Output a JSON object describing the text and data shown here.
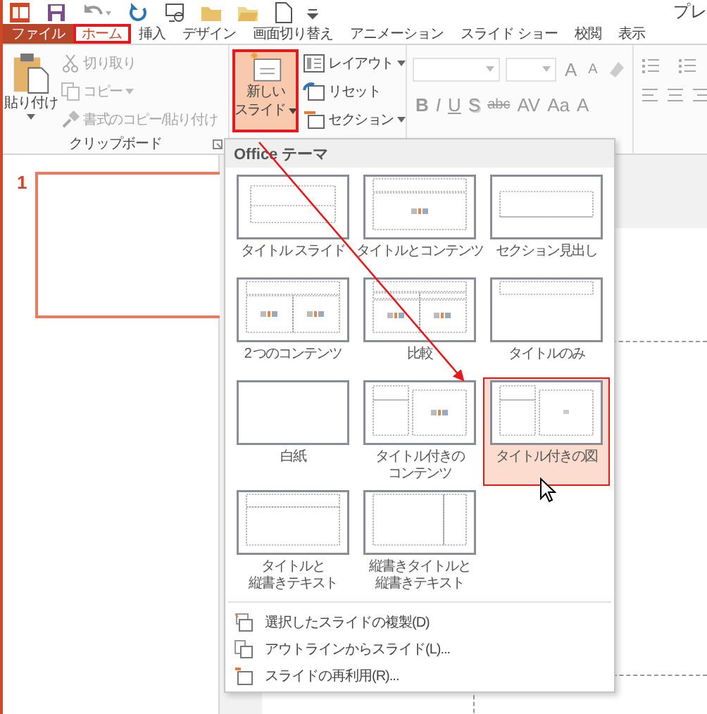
{
  "title_bar": {
    "title": "プレ"
  },
  "tabs": [
    {
      "label": "ファイル",
      "kind": "file",
      "selected": false,
      "highlighted": false
    },
    {
      "label": "ホーム",
      "kind": "tab",
      "selected": true,
      "highlighted": true
    },
    {
      "label": "挿入",
      "kind": "tab",
      "selected": false,
      "highlighted": false
    },
    {
      "label": "デザイン",
      "kind": "tab",
      "selected": false,
      "highlighted": false
    },
    {
      "label": "画面切り替え",
      "kind": "tab",
      "selected": false,
      "highlighted": false
    },
    {
      "label": "アニメーション",
      "kind": "tab",
      "selected": false,
      "highlighted": false
    },
    {
      "label": "スライド ショー",
      "kind": "tab",
      "selected": false,
      "highlighted": false
    },
    {
      "label": "校閲",
      "kind": "tab",
      "selected": false,
      "highlighted": false
    },
    {
      "label": "表示",
      "kind": "tab",
      "selected": false,
      "highlighted": false
    }
  ],
  "clipboard_group": {
    "title": "クリップボード",
    "paste": {
      "label": "貼り付け"
    },
    "commands": [
      {
        "label": "切り取り",
        "disabled": true,
        "dropdown": false
      },
      {
        "label": "コピー",
        "disabled": true,
        "dropdown": true
      },
      {
        "label": "書式のコピー/貼り付け",
        "disabled": true,
        "dropdown": false
      }
    ]
  },
  "slides_group": {
    "new_slide": {
      "lines": [
        "新しい",
        "スライド"
      ],
      "pressed": true,
      "highlighted": true
    },
    "commands": [
      {
        "label": "レイアウト",
        "dropdown": true
      },
      {
        "label": "リセット",
        "dropdown": false
      },
      {
        "label": "セクション",
        "dropdown": true
      }
    ]
  },
  "font_group": {
    "size_buttons": [
      {
        "label": "A",
        "kind": "grow",
        "disabled": true
      },
      {
        "label": "A",
        "kind": "shrink",
        "disabled": true
      }
    ],
    "format_buttons": [
      {
        "label": "B",
        "kind": "bold",
        "disabled": true
      },
      {
        "label": "I",
        "kind": "italic",
        "disabled": true
      },
      {
        "label": "U",
        "kind": "underline",
        "disabled": true
      },
      {
        "label": "S",
        "kind": "shadow",
        "disabled": true
      },
      {
        "label": "abc",
        "kind": "strike",
        "disabled": true
      },
      {
        "label": "AV",
        "kind": "spacing",
        "disabled": true
      },
      {
        "label": "Aa",
        "kind": "case",
        "disabled": true
      },
      {
        "label": "A",
        "kind": "color",
        "disabled": true
      }
    ]
  },
  "slide_panel": {
    "slides": [
      {
        "number": "1",
        "selected": true
      }
    ]
  },
  "layout_menu": {
    "header": "Office テーマ",
    "layouts": [
      {
        "lines": [
          "タイトル スライド"
        ],
        "kind": "title",
        "selected": false
      },
      {
        "lines": [
          "タイトルとコンテンツ"
        ],
        "kind": "title_content",
        "selected": false
      },
      {
        "lines": [
          "セクション見出し"
        ],
        "kind": "section",
        "selected": false
      },
      {
        "lines": [
          "2 つのコンテンツ"
        ],
        "kind": "two_content",
        "selected": false
      },
      {
        "lines": [
          "比較"
        ],
        "kind": "comparison",
        "selected": false
      },
      {
        "lines": [
          "タイトルのみ"
        ],
        "kind": "title_only",
        "selected": false
      },
      {
        "lines": [
          "白紙"
        ],
        "kind": "blank",
        "selected": false
      },
      {
        "lines": [
          "タイトル付きの",
          "コンテンツ"
        ],
        "kind": "content_caption",
        "selected": false
      },
      {
        "lines": [
          "タイトル付きの図"
        ],
        "kind": "picture_caption",
        "selected": true
      },
      {
        "lines": [
          "タイトルと",
          "縦書きテキスト"
        ],
        "kind": "vertical_text",
        "selected": false
      },
      {
        "lines": [
          "縦書きタイトルと",
          "縦書きテキスト"
        ],
        "kind": "vertical_title",
        "selected": false
      }
    ],
    "commands": [
      {
        "label": "選択したスライドの複製(D)"
      },
      {
        "label": "アウトラインからスライド(L)..."
      },
      {
        "label": "スライドの再利用(R)..."
      }
    ]
  }
}
